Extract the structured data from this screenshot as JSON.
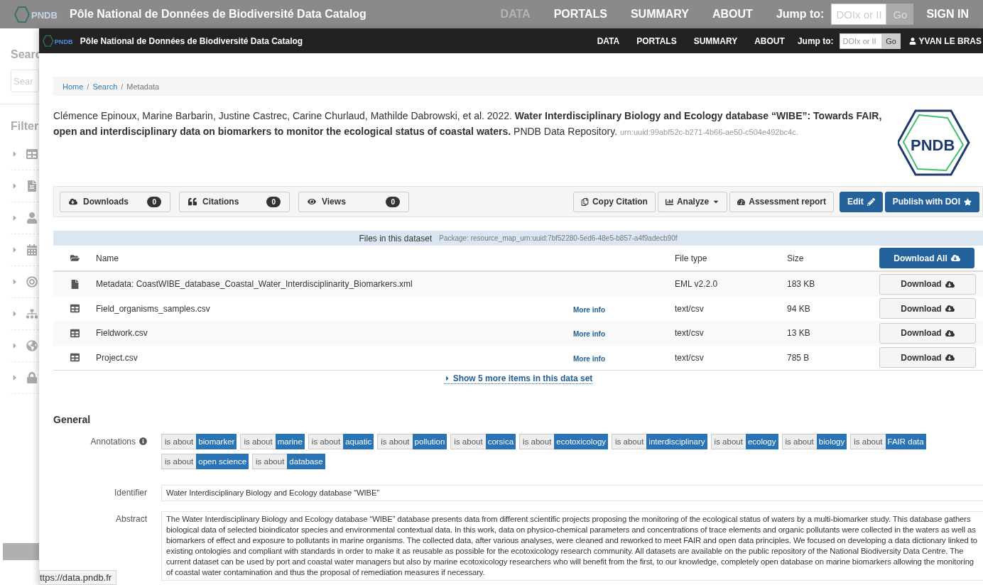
{
  "background_page": {
    "header": {
      "logo": "PNDB",
      "title": "Pôle National de Données de Biodiversité Data Catalog",
      "nav": [
        {
          "label": "DATA",
          "selected": true
        },
        {
          "label": "PORTALS",
          "selected": false
        },
        {
          "label": "SUMMARY",
          "selected": false
        },
        {
          "label": "ABOUT",
          "selected": false
        }
      ],
      "jump_label": "Jump to:",
      "jump_placeholder": "DOIx or II",
      "go": "Go",
      "sign_in": "SIGN IN"
    },
    "sidebar": {
      "search_label": "Searc",
      "search_placeholder": "Sear",
      "filter_label": "Filter",
      "filters": [
        {
          "kind": "table"
        },
        {
          "kind": "file"
        },
        {
          "kind": "person"
        },
        {
          "kind": "calendar"
        },
        {
          "kind": "target"
        },
        {
          "kind": "hierarchy"
        },
        {
          "kind": "globe"
        },
        {
          "kind": "lock"
        }
      ]
    }
  },
  "window": {
    "header": {
      "logo": "PNDB",
      "title": "Pôle National de Données de Biodiversité Data Catalog",
      "nav": [
        {
          "label": "DATA",
          "selected": false
        },
        {
          "label": "PORTALS",
          "selected": false
        },
        {
          "label": "SUMMARY",
          "selected": false
        },
        {
          "label": "ABOUT",
          "selected": false
        }
      ],
      "jump_label": "Jump to:",
      "jump_placeholder": "DOIx or II",
      "go": "Go",
      "user": "YVAN LE BRAS"
    },
    "breadcrumb": {
      "separator": "/",
      "items": [
        {
          "label": "Home",
          "selected": false
        },
        {
          "label": "Search",
          "selected": false
        },
        {
          "label": "Metadata",
          "selected": true
        }
      ]
    },
    "citation": {
      "text": "Clémence Epinoux, Marine Barbarin, Justine Castrec, Carine Churlaud, Mathilde Dabrowski, et al. 2022. **Water Interdisciplinary Biology and Ecology database “WIBE”: Towards FAIR, open and interdisciplinary data on biomarkers to monitor the ecological status of coastal waters.** PNDB Data Repository.",
      "id": "urn:uuid:99abf52c-b271-4b66-ae50-c504e492bc4c."
    },
    "logo": "PNDB",
    "metrics": [
      {
        "kind": "downloads",
        "label": "Downloads",
        "count": "0"
      },
      {
        "kind": "citations",
        "label": "Citations",
        "count": "0"
      },
      {
        "kind": "views",
        "label": "Views",
        "count": "0"
      }
    ],
    "actions": [
      {
        "kind": "copy",
        "label": "Copy Citation"
      },
      {
        "kind": "analyze",
        "label": "Analyze"
      },
      {
        "kind": "assessment",
        "label": "Assessment report"
      },
      {
        "kind": "edit",
        "label": "Edit"
      },
      {
        "kind": "publish",
        "label": "Publish with DOI"
      }
    ],
    "files": {
      "title": "Files in this dataset",
      "package": "Package: resource_map_urn:uuid:7bf52280-5ed6-48e5-b857-a4f9adecb90f",
      "columns": [
        "Name",
        "File type",
        "Size"
      ],
      "download_all": "Download All",
      "rows": [
        {
          "kind": "metadata",
          "name": "Metadata: CoastWIBE_database_Coastal_Water_Interdisciplinarity_Biomarkers.xml",
          "type": "EML v2.2.0",
          "size": "183 KB",
          "action": "Download"
        },
        {
          "kind": "table",
          "name": "Field_organisms_samples.csv",
          "more_info": "More info",
          "type": "text/csv",
          "size": "94 KB",
          "action": "Download"
        },
        {
          "kind": "table",
          "name": "Fieldwork.csv",
          "more_info": "More info",
          "type": "text/csv",
          "size": "13 KB",
          "action": "Download"
        },
        {
          "kind": "table",
          "name": "Project.csv",
          "more_info": "More info",
          "type": "text/csv",
          "size": "785 B",
          "action": "Download"
        }
      ],
      "show_more": "Show 5 more items in this data set"
    },
    "general": {
      "heading": "General",
      "annotations_label": "Annotations",
      "annotations": [
        {
          "prefix": "is about",
          "term": "biomarker"
        },
        {
          "prefix": "is about",
          "term": "marine"
        },
        {
          "prefix": "is about",
          "term": "aquatic"
        },
        {
          "prefix": "is about",
          "term": "pollution"
        },
        {
          "prefix": "is about",
          "term": "corsica"
        },
        {
          "prefix": "is about",
          "term": "ecotoxicology"
        },
        {
          "prefix": "is about",
          "term": "interdisciplinary"
        },
        {
          "prefix": "is about",
          "term": "ecology"
        },
        {
          "prefix": "is about",
          "term": "biology"
        },
        {
          "prefix": "is about",
          "term": "FAIR data"
        },
        {
          "prefix": "is about",
          "term": "open science"
        },
        {
          "prefix": "is about",
          "term": "database"
        }
      ],
      "fields": [
        {
          "label": "Identifier",
          "value": "Water Interdisciplinary Biology and Ecology database “WIBE”"
        },
        {
          "label": "Abstract",
          "value": "The Water Interdisciplinary Biology and Ecology database “WIBE” database presents data from different scientific projects proposing the monitoring of the ecological status of waters by a multi-biomarker study. This database gathers biological data of selected bioindicator species and environmental contextual data. In this work, data on physico-chemical parameters and concentrations of trace elements and organic pollutants were collected in the waters as well as biomarkers of effect and exposure to pollutants in marine organisms. The collected data, after various analyses, were cleaned and reworked to meet FAIR and open data principles. We focused on developing a data dictionary linked to existing ontologies and compliant with standards in order to make it as reusable as possible for the ecotoxicology research community. All datasets are available on the public repository of the National Biodiversity Data Centre. The current dataset can be used by port and coastal water managers but also by marine ecotoxicology researchers who will benefit from the first, to our knowledge, completely open database on marine biomarkers allowing the monitoring of coastal water contamination and thus the proposal of remediation measures if necessary."
        }
      ]
    }
  },
  "status_url": "ttps://data.pndb.fr"
}
